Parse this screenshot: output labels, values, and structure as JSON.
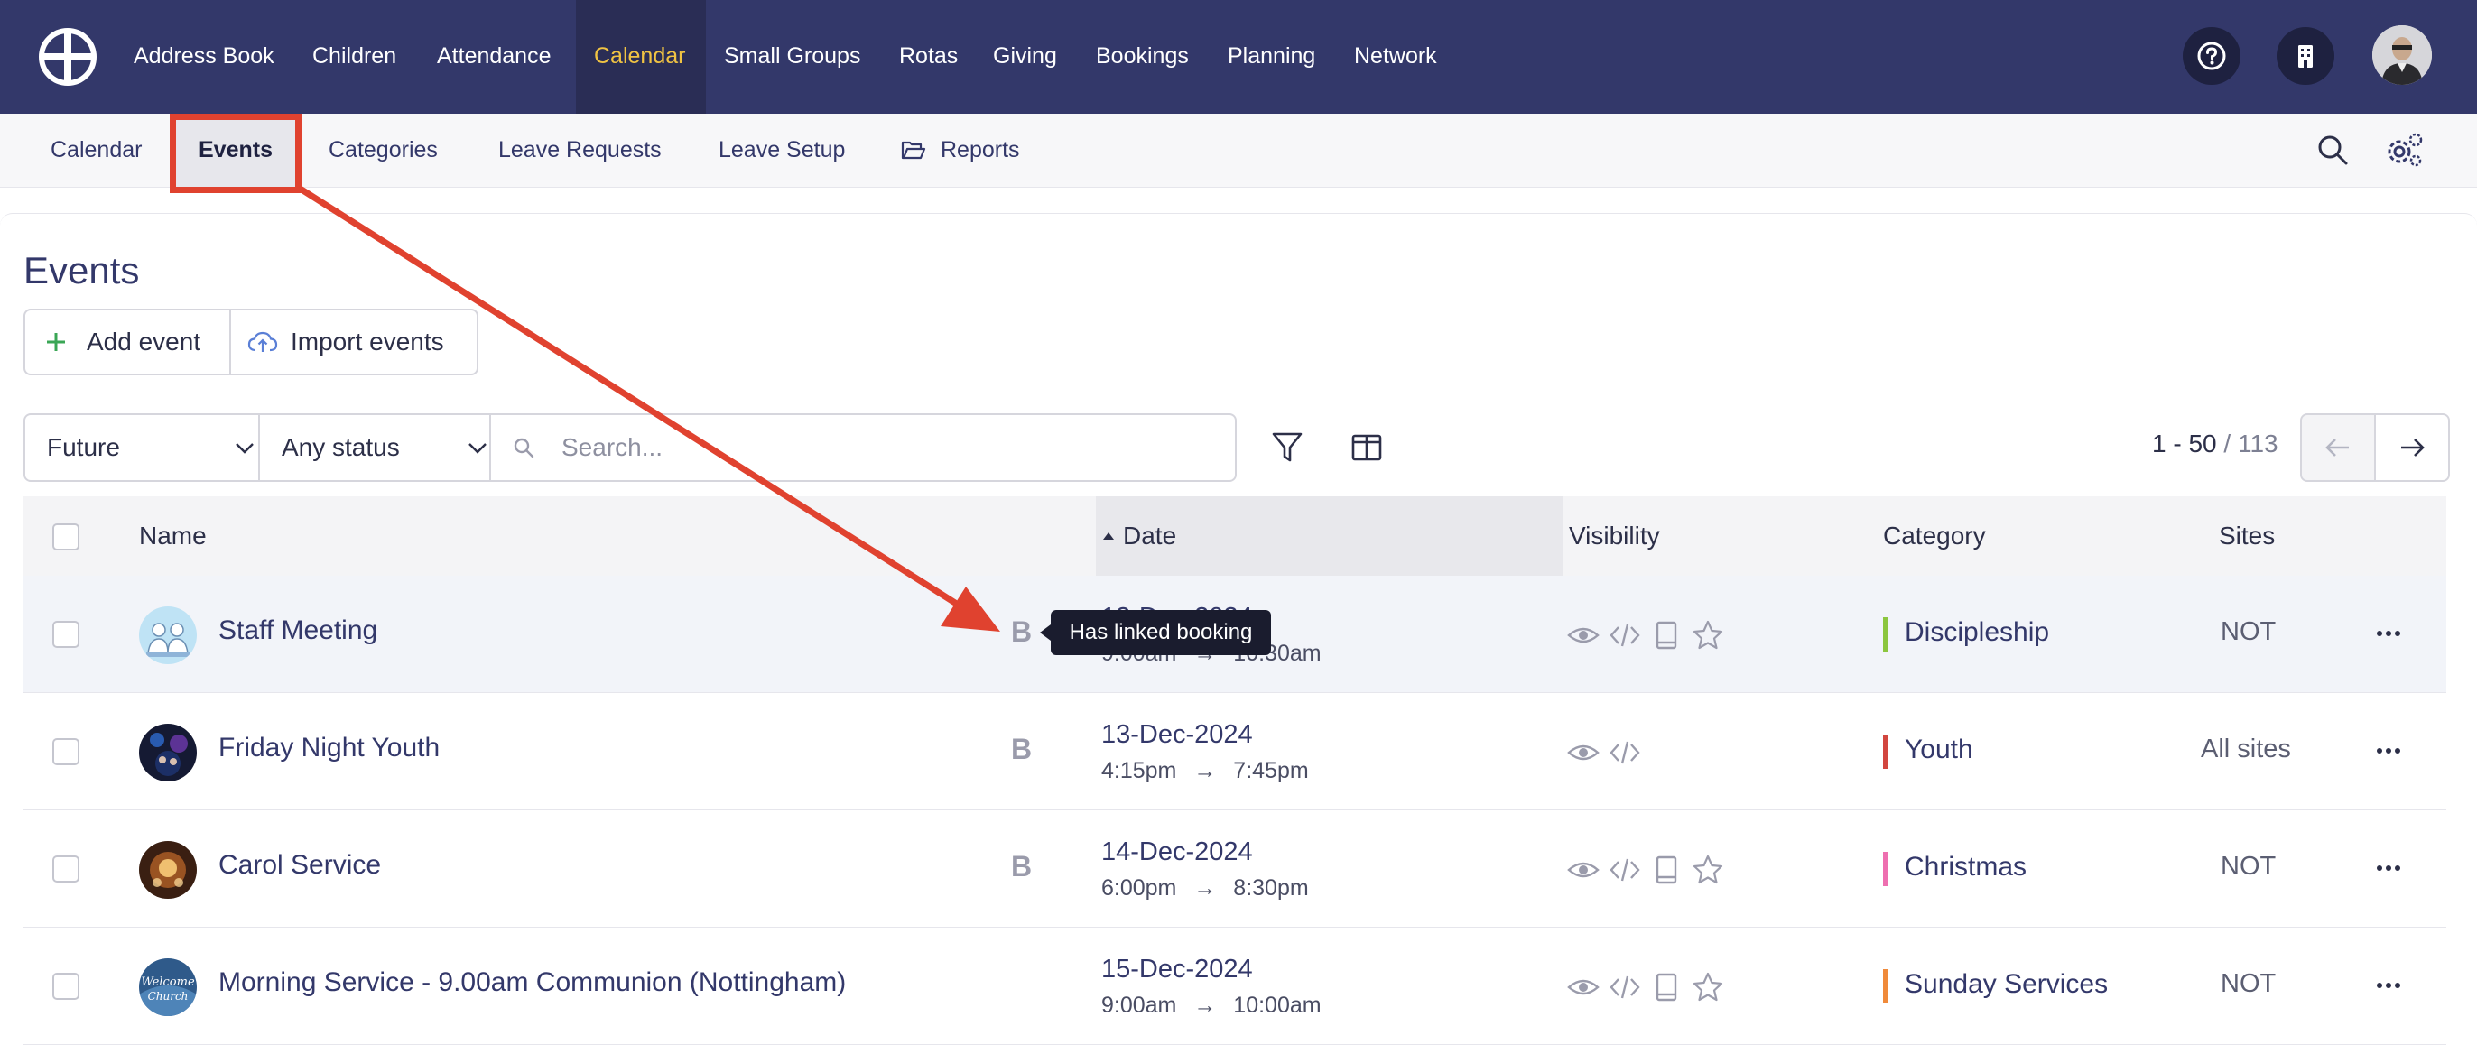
{
  "topnav": {
    "items": [
      "Address Book",
      "Children",
      "Attendance",
      "Calendar",
      "Small Groups",
      "Rotas",
      "Giving",
      "Bookings",
      "Planning",
      "Network"
    ],
    "active": "Calendar",
    "icons": [
      "help-icon",
      "building-icon",
      "user-avatar"
    ]
  },
  "subnav": {
    "items": [
      "Calendar",
      "Events",
      "Categories",
      "Leave Requests",
      "Leave Setup",
      "Reports"
    ],
    "active": "Events",
    "icons": [
      "search-icon",
      "settings-icon"
    ]
  },
  "page": {
    "title": "Events",
    "add_event": "Add event",
    "import_events": "Import events"
  },
  "filters": {
    "period": "Future",
    "status": "Any status",
    "search_placeholder": "Search..."
  },
  "pager": {
    "range": "1 - 50",
    "total": "/ 113"
  },
  "table": {
    "headers": {
      "name": "Name",
      "date": "Date",
      "visibility": "Visibility",
      "category": "Category",
      "sites": "Sites"
    },
    "rows": [
      {
        "name": "Staff Meeting",
        "date": "13-Dec-2024",
        "start": "9:00am",
        "end": "10:30am",
        "has_booking": true,
        "visibility_icons": [
          "eye",
          "code",
          "tablet",
          "star"
        ],
        "category": "Discipleship",
        "category_color": "#8cc63f",
        "sites": "NOT"
      },
      {
        "name": "Friday Night Youth",
        "date": "13-Dec-2024",
        "start": "4:15pm",
        "end": "7:45pm",
        "has_booking": true,
        "visibility_icons": [
          "eye",
          "code"
        ],
        "category": "Youth",
        "category_color": "#d2463f",
        "sites": "All sites"
      },
      {
        "name": "Carol Service",
        "date": "14-Dec-2024",
        "start": "6:00pm",
        "end": "8:30pm",
        "has_booking": true,
        "visibility_icons": [
          "eye",
          "code",
          "tablet",
          "star"
        ],
        "category": "Christmas",
        "category_color": "#ee6fb0",
        "sites": "NOT"
      },
      {
        "name": "Morning Service - 9.00am Communion (Nottingham)",
        "date": "15-Dec-2024",
        "start": "9:00am",
        "end": "10:00am",
        "has_booking": false,
        "visibility_icons": [
          "eye",
          "code",
          "tablet",
          "star"
        ],
        "category": "Sunday Services",
        "category_color": "#f08a3a",
        "sites": "NOT"
      }
    ]
  },
  "booking_letter": "B",
  "tooltip": "Has linked booking",
  "time_arrow": "→",
  "colors": {
    "nav_bg": "#33386a",
    "nav_active_text": "#f0c343",
    "annotation_red": "#e0422f"
  }
}
